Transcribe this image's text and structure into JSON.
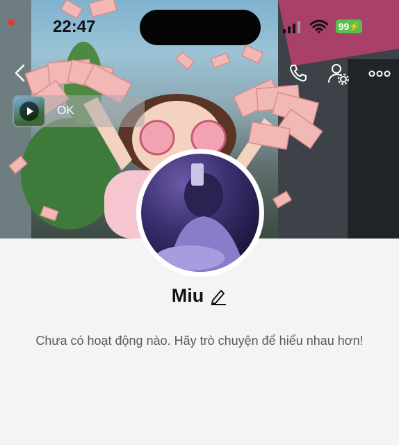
{
  "status_bar": {
    "time": "22:47",
    "battery": "99"
  },
  "media_chip": {
    "label": "OK"
  },
  "profile": {
    "name": "Miu"
  },
  "feed": {
    "empty_message": "Chưa có hoạt động nào. Hãy trò chuyện để hiểu nhau hơn!"
  },
  "icons": [
    "recording-dot",
    "signal-icon",
    "wifi-icon",
    "battery-icon",
    "back-icon",
    "call-icon",
    "user-settings-icon",
    "more-icon",
    "play-icon",
    "edit-icon"
  ],
  "colors": {
    "background": "#f3f4f6",
    "battery": "#58c14a",
    "recording": "#e53935",
    "text_primary": "#111111",
    "text_secondary": "#5a5a5a"
  }
}
